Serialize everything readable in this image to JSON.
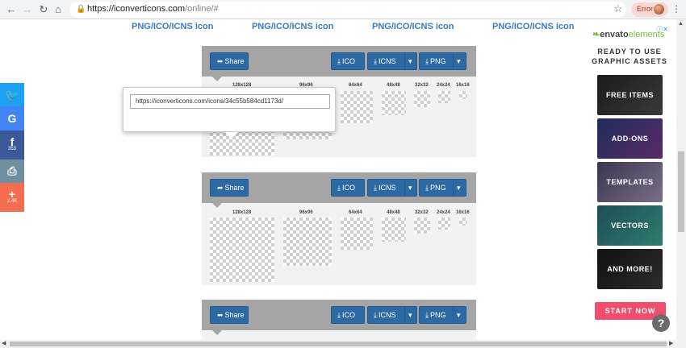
{
  "browser": {
    "url_host": "https://iconverticons.com",
    "url_path": "/online/#",
    "error_label": "Error"
  },
  "top_links": [
    "PNG/ICO/ICNS icon",
    "PNG/ICO/ICNS icon",
    "PNG/ICO/ICNS icon",
    "PNG/ICO/ICNS icon"
  ],
  "card": {
    "share_label": "Share",
    "ico_label": "ICO",
    "icns_label": "ICNS",
    "png_label": "PNG",
    "sizes": [
      "128x128",
      "96x96",
      "64x64",
      "48x48",
      "32x32",
      "24x24",
      "16x16"
    ]
  },
  "popover": {
    "share_url": "https://iconverticons.com/icons/34c55b584cd1173d/"
  },
  "social": {
    "facebook_count": "353",
    "more_count": "2.4K"
  },
  "ad": {
    "brand_envato": "envato",
    "brand_elements": "elements",
    "headline": "READY TO USE GRAPHIC ASSETS",
    "tiles": [
      "FREE ITEMS",
      "ADD-ONS",
      "TEMPLATES",
      "VECTORS",
      "AND MORE!"
    ],
    "cta": "START NOW",
    "colors": {
      "cta": "#f34d6d",
      "brand": "#7fb93a"
    }
  }
}
